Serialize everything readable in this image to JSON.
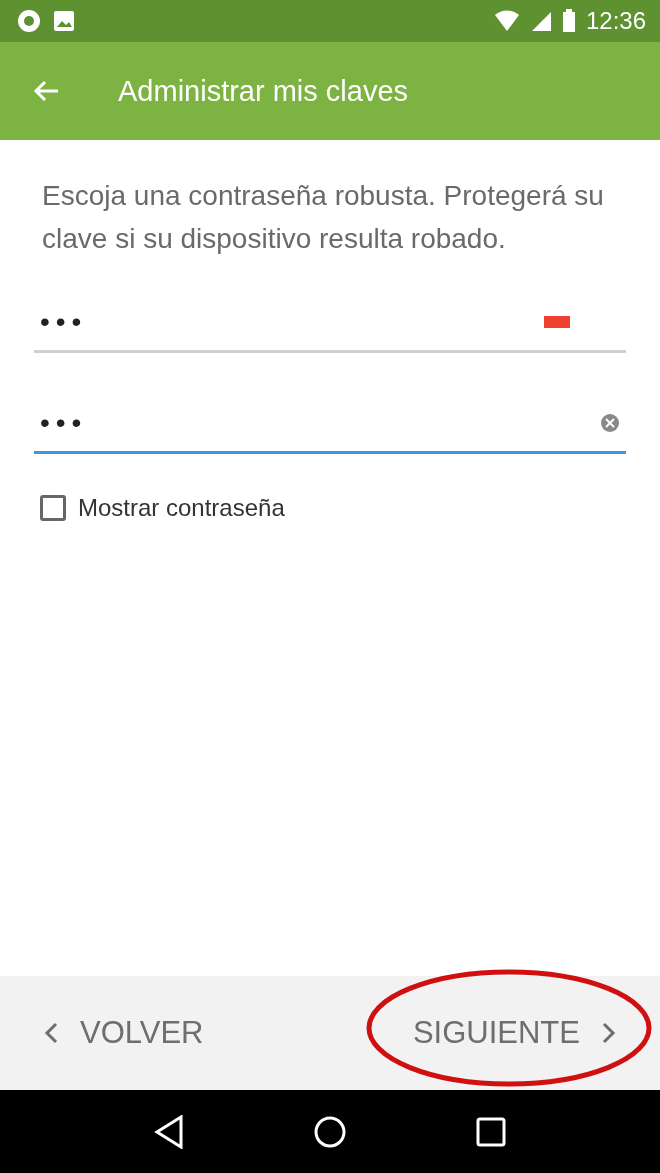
{
  "status_bar": {
    "time": "12:36"
  },
  "toolbar": {
    "title": "Administrar mis claves"
  },
  "intro": "Escoja una contraseña robusta. Protegerá su clave si su dispositivo resulta robado.",
  "fields": [
    {
      "value": "•••",
      "focused": false,
      "kind": "strength"
    },
    {
      "value": "•••",
      "focused": true,
      "kind": "clear"
    }
  ],
  "show_password": {
    "label": "Mostrar contraseña",
    "checked": false
  },
  "footer": {
    "back": "VOLVER",
    "next": "SIGUIENTE",
    "next_highlighted": true
  }
}
